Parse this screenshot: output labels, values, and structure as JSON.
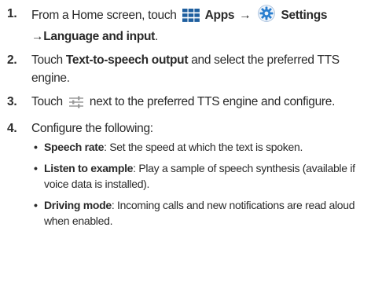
{
  "steps": [
    {
      "number": "1.",
      "text_from": "From a Home screen, touch",
      "apps_icon": "apps-grid-icon",
      "apps_label": "Apps",
      "arrow1": "→",
      "settings_icon": "settings-gear-icon",
      "settings_label": "Settings",
      "arrow2": "→",
      "language_label": "Language and input",
      "period": "."
    },
    {
      "number": "2.",
      "text_touch": "Touch",
      "tts_output_label": "Text-to-speech output",
      "text_rest": "and select the preferred TTS engine."
    },
    {
      "number": "3.",
      "text_touch": "Touch",
      "settings_sliders_icon": "settings-sliders-icon",
      "text_rest": "next to the preferred TTS engine and configure."
    },
    {
      "number": "4.",
      "text": "Configure the following:",
      "items": [
        {
          "bullet": "•",
          "label": "Speech rate",
          "text": ": Set the speed at which the text is spoken."
        },
        {
          "bullet": "•",
          "label": "Listen to example",
          "text": ": Play a sample of speech synthesis (available if voice data is installed)."
        },
        {
          "bullet": "•",
          "label": "Driving mode",
          "text": ": Incoming calls and new notifications are read aloud when enabled."
        }
      ]
    }
  ],
  "colors": {
    "text": "#2a2a2a",
    "apps_icon_blue": "#1f5f9f",
    "settings_icon_blue": "#2b7fcf"
  }
}
